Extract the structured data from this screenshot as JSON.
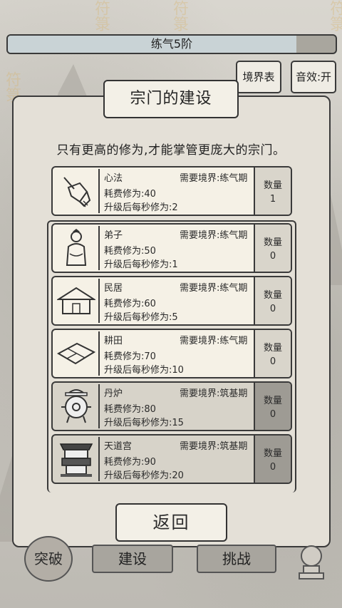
{
  "level": {
    "label": "练气5阶",
    "progress": 0.88
  },
  "buttons": {
    "realm_table": "境界表",
    "sound": "音效:开",
    "back": "返回"
  },
  "panel": {
    "title": "宗门的建设",
    "subtitle": "只有更高的修为,才能掌管更庞大的宗门。"
  },
  "count_label": "数量",
  "items": [
    {
      "name": "心法",
      "req": "需要境界:练气期",
      "cost": "耗费修为:40",
      "rate": "升级后每秒修为:2",
      "count": "1",
      "icon": "hand-icon"
    },
    {
      "name": "弟子",
      "req": "需要境界:练气期",
      "cost": "耗费修为:50",
      "rate": "升级后每秒修为:1",
      "count": "0",
      "icon": "disciple-icon"
    },
    {
      "name": "民居",
      "req": "需要境界:练气期",
      "cost": "耗费修为:60",
      "rate": "升级后每秒修为:5",
      "count": "0",
      "icon": "house-icon"
    },
    {
      "name": "耕田",
      "req": "需要境界:练气期",
      "cost": "耗费修为:70",
      "rate": "升级后每秒修为:10",
      "count": "0",
      "icon": "field-icon"
    },
    {
      "name": "丹炉",
      "req": "需要境界:筑基期",
      "cost": "耗费修为:80",
      "rate": "升级后每秒修为:15",
      "count": "0",
      "icon": "furnace-icon"
    },
    {
      "name": "天道宫",
      "req": "需要境界:筑基期",
      "cost": "耗费修为:90",
      "rate": "升级后每秒修为:20",
      "count": "0",
      "icon": "palace-icon"
    }
  ],
  "nav": {
    "breakthrough": "突破",
    "build": "建设",
    "challenge": "挑战"
  }
}
